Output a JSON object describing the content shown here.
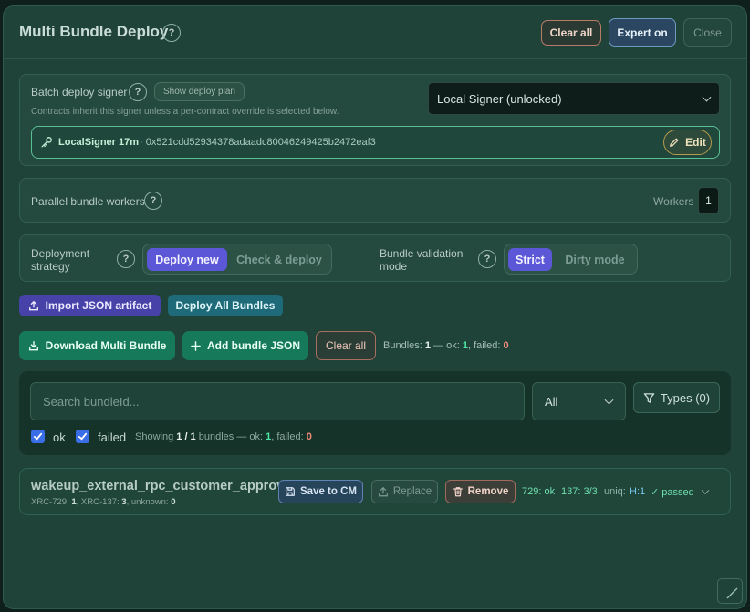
{
  "header": {
    "title": "Multi Bundle Deploy",
    "help": "?",
    "clear_all": "Clear all",
    "expert": "Expert on",
    "close": "Close"
  },
  "signer": {
    "label": "Batch deploy signer",
    "show_plan": "Show deploy plan",
    "note": "Contracts inherit this signer unless a per-contract override is selected below.",
    "selected": "Local Signer (unlocked)",
    "name": "LocalSigner 17m",
    "address": "· 0x521cdd52934378adaadc80046249425b2472eaf3",
    "edit": "Edit"
  },
  "workers": {
    "label": "Parallel bundle workers",
    "workers_label": "Workers",
    "value": "1"
  },
  "strategy": {
    "label": "Deployment strategy",
    "options": [
      "Deploy new",
      "Check & deploy"
    ],
    "selected": "Deploy new",
    "validation_label": "Bundle validation mode",
    "validation_options": [
      "Strict",
      "Dirty mode"
    ],
    "validation_selected": "Strict"
  },
  "actions": {
    "import": "Import JSON artifact",
    "deploy_all": "Deploy All Bundles",
    "download": "Download Multi Bundle",
    "add_bundle": "Add bundle JSON",
    "clear_all": "Clear all"
  },
  "stats": {
    "prefix": "Bundles: ",
    "count": "1",
    "ok_label": " — ok: ",
    "ok": "1",
    "failed_label": ", failed: ",
    "failed": "0"
  },
  "filter": {
    "search_placeholder": "Search bundleId...",
    "type_select": "All",
    "types_button": "Types (0)",
    "check_ok": "ok",
    "check_failed": "failed",
    "showing_prefix": "Showing ",
    "showing_count": "1 / 1",
    "showing_mid": " bundles — ok: ",
    "showing_ok": "1",
    "showing_failed_label": ", failed: ",
    "showing_failed": "0"
  },
  "bundle": {
    "name": "wakeup_external_rpc_customer_approval",
    "meta_a": "XRC-729: ",
    "meta_a_val": "1",
    "meta_b": ", XRC-137: ",
    "meta_b_val": "3",
    "meta_c": ", unknown: ",
    "meta_c_val": "0",
    "save": "Save to CM",
    "replace": "Replace",
    "remove": "Remove",
    "s729": "729: ok",
    "s137": "137: 3/3",
    "uniq_label": "uniq:",
    "uniq_val": "H:1",
    "passed": "✓ passed"
  },
  "colors": {
    "accent_purple": "#5b57d6",
    "ok_green": "#4ee6a5",
    "fail_red": "#f28a78",
    "primary_green": "#16795a"
  }
}
